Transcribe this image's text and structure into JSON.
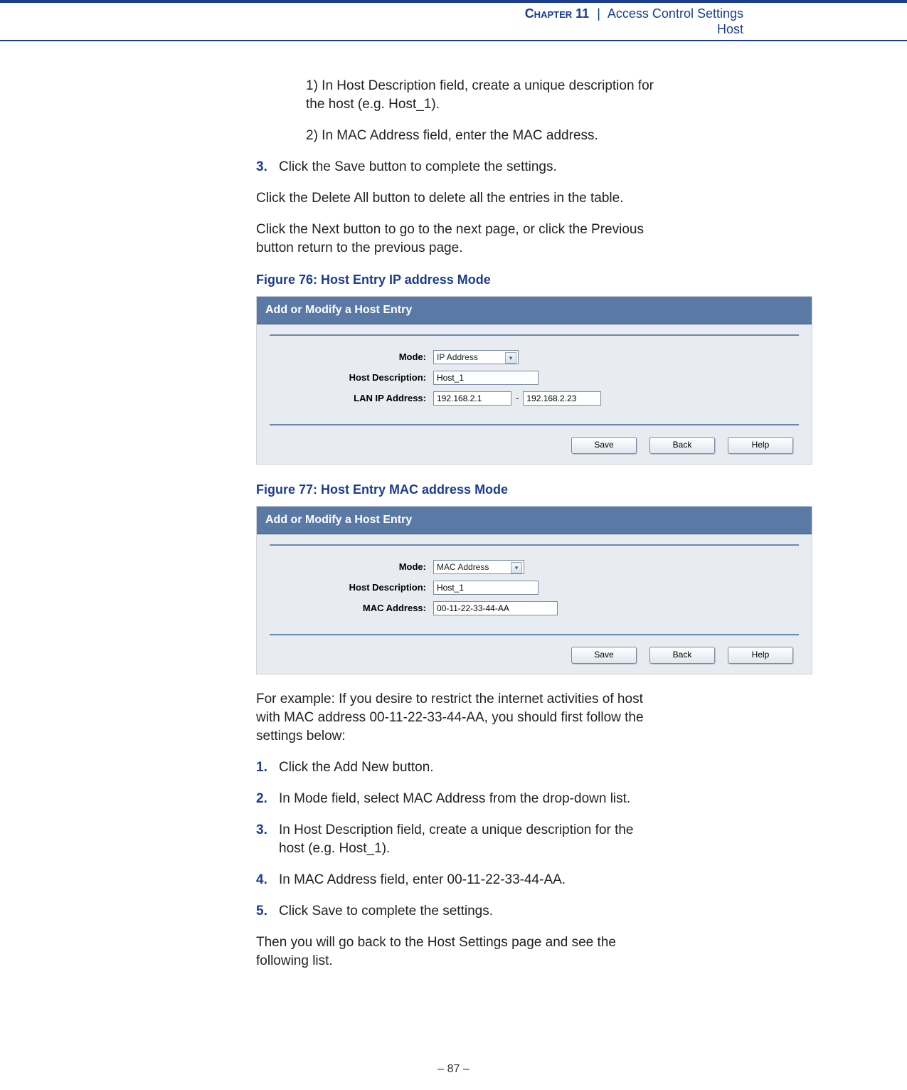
{
  "header": {
    "chapter_word": "Chapter",
    "chapter_num": "11",
    "separator": "|",
    "title": "Access Control Settings",
    "subtitle": "Host"
  },
  "content": {
    "sub1": "1) In Host Description field, create a unique description for the host (e.g. Host_1).",
    "sub2": "2) In MAC Address field, enter the MAC address.",
    "step3_num": "3.",
    "step3_text": "Click the Save button to complete the settings.",
    "deleteAll": "Click the Delete All button to delete all the entries in the table.",
    "nextPrev": "Click the Next button to go to the next page, or click the Previous button return to the previous page.",
    "fig76_caption": "Figure 76:   Host Entry IP address Mode",
    "fig77_caption": "Figure 77:   Host Entry MAC address Mode",
    "example_intro": "For example: If you desire to restrict the internet activities of host with MAC address 00-11-22-33-44-AA, you should first follow the settings below:",
    "ex1_num": "1.",
    "ex1_text": "Click the Add New button.",
    "ex2_num": "2.",
    "ex2_text": "In Mode field, select MAC Address from the drop-down list.",
    "ex3_num": "3.",
    "ex3_text": "In Host Description field, create a unique description for the host (e.g. Host_1).",
    "ex4_num": "4.",
    "ex4_text": "In MAC Address field, enter 00-11-22-33-44-AA.",
    "ex5_num": "5.",
    "ex5_text": "Click Save to complete the settings.",
    "closing": "Then you will go back to the Host Settings page and see the following list."
  },
  "fig76": {
    "panel_title": "Add or Modify a Host Entry",
    "mode_label": "Mode:",
    "mode_value": "IP Address",
    "desc_label": "Host Description:",
    "desc_value": "Host_1",
    "ip_label": "LAN IP Address:",
    "ip_from": "192.168.2.1",
    "ip_to": "192.168.2.23",
    "btn_save": "Save",
    "btn_back": "Back",
    "btn_help": "Help"
  },
  "fig77": {
    "panel_title": "Add or Modify a Host Entry",
    "mode_label": "Mode:",
    "mode_value": "MAC Address",
    "desc_label": "Host Description:",
    "desc_value": "Host_1",
    "mac_label": "MAC Address:",
    "mac_value": "00-11-22-33-44-AA",
    "btn_save": "Save",
    "btn_back": "Back",
    "btn_help": "Help"
  },
  "footer": {
    "page": "–  87  –"
  }
}
